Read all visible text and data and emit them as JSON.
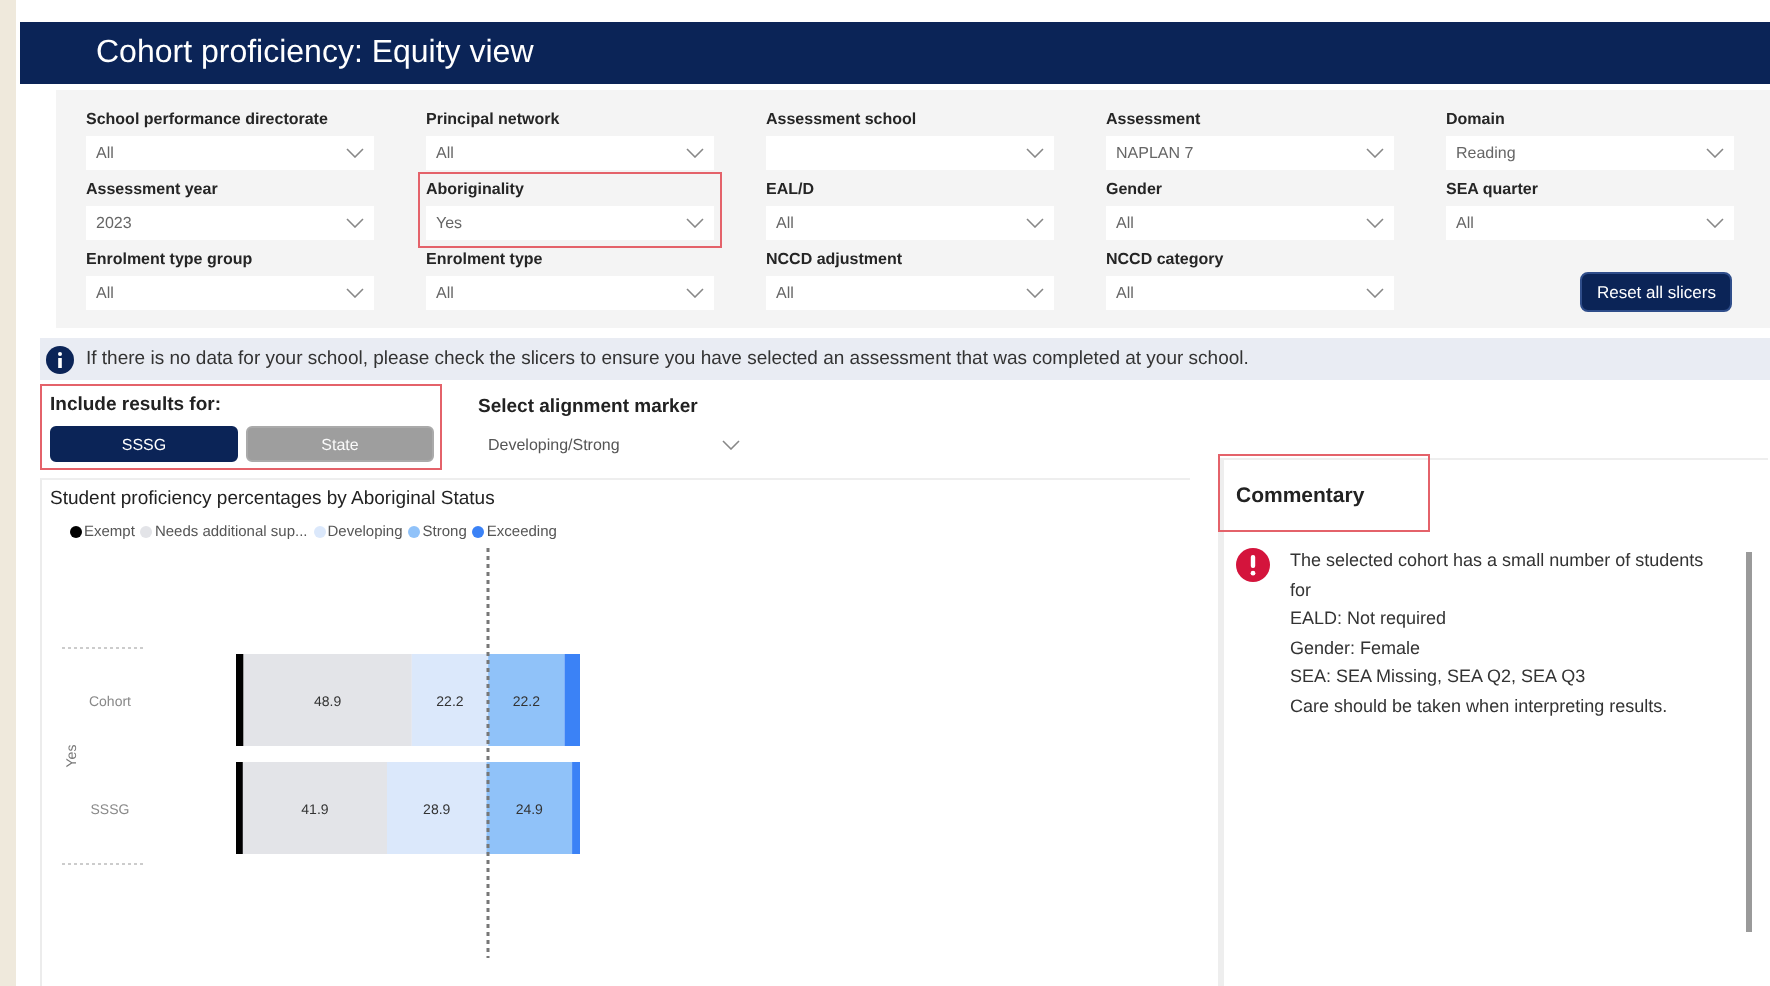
{
  "window": {
    "title": "Cohort proficiency: Equity view"
  },
  "filters": [
    {
      "label": "School performance directorate",
      "value": "All",
      "highlighted": false
    },
    {
      "label": "Principal network",
      "value": "All",
      "highlighted": false
    },
    {
      "label": "Assessment school",
      "highlighted": false
    },
    {
      "label": "Assessment",
      "value": "NAPLAN 7",
      "highlighted": false
    },
    {
      "label": "Domain",
      "value": "Reading",
      "highlighted": false
    },
    {
      "label": "Assessment year",
      "value": "2023",
      "highlighted": false
    },
    {
      "label": "Aboriginality",
      "value": "Yes",
      "highlighted": true
    },
    {
      "label": "EAL/D",
      "value": "All",
      "highlighted": false
    },
    {
      "label": "Gender",
      "value": "All",
      "highlighted": false
    },
    {
      "label": "SEA quarter",
      "value": "All",
      "highlighted": false
    },
    {
      "label": "Enrolment type group",
      "value": "All",
      "highlighted": false
    },
    {
      "label": "Enrolment type",
      "value": "All",
      "highlighted": false
    },
    {
      "label": "NCCD adjustment",
      "value": "All",
      "highlighted": false
    },
    {
      "label": "NCCD category",
      "value": "All",
      "highlighted": false
    }
  ],
  "reset_button": "Reset all slicers",
  "info_message": "If there is no data for your school, please check the slicers to ensure you have selected an assessment that was completed at your school.",
  "include_results": {
    "label": "Include results for:",
    "highlighted": true,
    "options": [
      {
        "label": "SSSG",
        "selected": true
      },
      {
        "label": "State",
        "selected": false
      }
    ]
  },
  "alignment_marker": {
    "label": "Select alignment marker",
    "value": "Developing/Strong"
  },
  "chart": {
    "group_label": "Yes",
    "marker_after": [
      false,
      false,
      true,
      false,
      false
    ],
    "chart_data": {
      "type": "bar",
      "orientation": "horizontal",
      "stacked": true,
      "title": "Student proficiency percentages by Aboriginal Status",
      "categories": [
        "Cohort",
        "SSSG"
      ],
      "series": [
        {
          "name": "Exempt",
          "color": "#000000",
          "values": [
            2.2,
            2.0
          ],
          "value_labels": [
            null,
            null
          ]
        },
        {
          "name": "Needs additional sup...",
          "color": "#e3e4e8",
          "values": [
            48.9,
            41.9
          ],
          "value_labels": [
            "48.9",
            "41.9"
          ]
        },
        {
          "name": "Developing",
          "color": "#dbe8fb",
          "values": [
            22.2,
            28.9
          ],
          "value_labels": [
            "22.2",
            "28.9"
          ]
        },
        {
          "name": "Strong",
          "color": "#90c2f9",
          "values": [
            22.2,
            24.9
          ],
          "value_labels": [
            "22.2",
            "24.9"
          ]
        },
        {
          "name": "Exceeding",
          "color": "#3b82f6",
          "values": [
            4.5,
            2.3
          ],
          "value_labels": [
            null,
            null
          ]
        }
      ]
    }
  },
  "commentary": {
    "title": "Commentary",
    "highlighted": true,
    "lines": [
      "The selected cohort has a small number of students for",
      "EALD: Not required",
      "Gender: Female",
      "SEA: SEA Missing, SEA Q2, SEA Q3",
      "Care should be taken when interpreting results."
    ]
  }
}
